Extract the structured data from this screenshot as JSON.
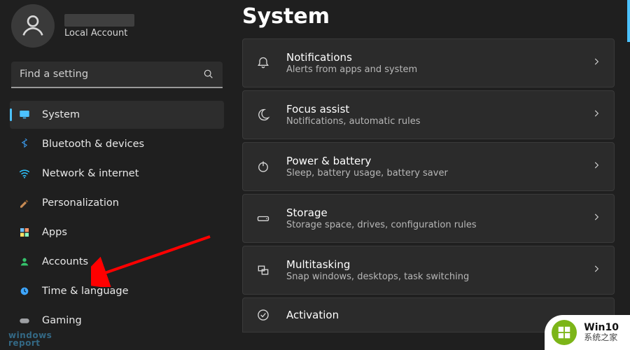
{
  "profile": {
    "subtitle": "Local Account"
  },
  "search": {
    "placeholder": "Find a setting"
  },
  "nav": [
    {
      "key": "system",
      "label": "System",
      "icon": "monitor",
      "selected": true
    },
    {
      "key": "bluetooth",
      "label": "Bluetooth & devices",
      "icon": "bluetooth",
      "selected": false
    },
    {
      "key": "network",
      "label": "Network & internet",
      "icon": "wifi",
      "selected": false
    },
    {
      "key": "personalize",
      "label": "Personalization",
      "icon": "brush",
      "selected": false
    },
    {
      "key": "apps",
      "label": "Apps",
      "icon": "apps",
      "selected": false
    },
    {
      "key": "accounts",
      "label": "Accounts",
      "icon": "person",
      "selected": false
    },
    {
      "key": "time",
      "label": "Time & language",
      "icon": "clock",
      "selected": false
    },
    {
      "key": "gaming",
      "label": "Gaming",
      "icon": "game",
      "selected": false
    }
  ],
  "page": {
    "title": "System"
  },
  "cards": [
    {
      "key": "notifications",
      "title": "Notifications",
      "sub": "Alerts from apps and system",
      "icon": "bell"
    },
    {
      "key": "focus",
      "title": "Focus assist",
      "sub": "Notifications, automatic rules",
      "icon": "moon"
    },
    {
      "key": "power",
      "title": "Power & battery",
      "sub": "Sleep, battery usage, battery saver",
      "icon": "power"
    },
    {
      "key": "storage",
      "title": "Storage",
      "sub": "Storage space, drives, configuration rules",
      "icon": "drive"
    },
    {
      "key": "multitask",
      "title": "Multitasking",
      "sub": "Snap windows, desktops, task switching",
      "icon": "multi"
    },
    {
      "key": "activation",
      "title": "Activation",
      "sub": "",
      "icon": "check"
    }
  ],
  "watermarks": {
    "left_line1": "windows",
    "left_line2": "report",
    "right_line1": "Win10",
    "right_line2": "系统之家"
  },
  "colors": {
    "accent": "#4cc2ff",
    "annotation_arrow": "#ff0000"
  }
}
